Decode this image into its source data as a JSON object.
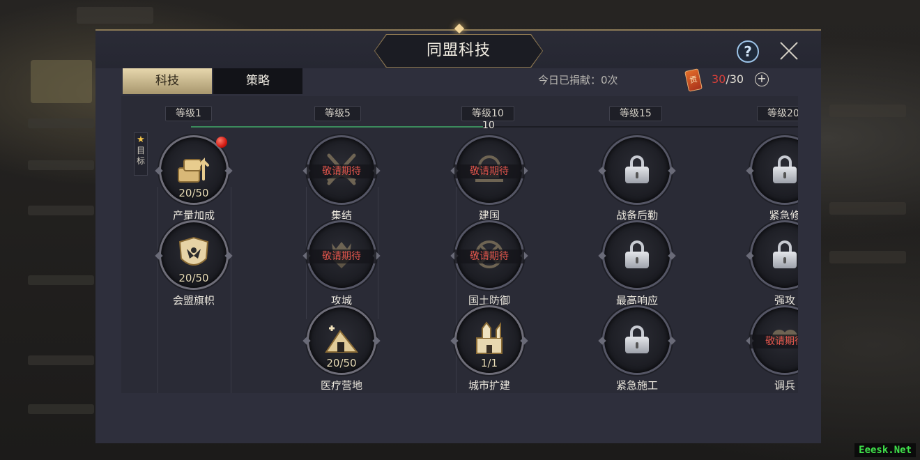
{
  "window": {
    "title": "同盟科技",
    "help_label": "?",
    "close_label": "close"
  },
  "tabs": [
    {
      "label": "科技",
      "active": true
    },
    {
      "label": "策略",
      "active": false
    }
  ],
  "donation": {
    "text": "今日已捐献：0次",
    "token_icon_label": "贡",
    "token_current": "30",
    "token_separator": "/",
    "token_max": "30",
    "plus_label": "+"
  },
  "levels": [
    {
      "label": "等级1"
    },
    {
      "label": "等级5"
    },
    {
      "label": "等级10"
    },
    {
      "label": "等级15"
    },
    {
      "label": "等级20"
    }
  ],
  "progress": {
    "label": "10",
    "fraction": 0.48
  },
  "goal": {
    "star": "★",
    "chars": [
      "目",
      "标"
    ]
  },
  "coming_soon_text": "敬请期待",
  "nodes": [
    {
      "name": "产量加成",
      "count": "20/50",
      "state": "unlocked",
      "icon": "resources-icon",
      "red_dot": true
    },
    {
      "name": "会盟旗帜",
      "count": "20/50",
      "state": "unlocked",
      "icon": "banner-shield-icon",
      "red_dot": false
    },
    {
      "name": "集结",
      "state": "coming-soon",
      "icon": "crossed-swords-icon"
    },
    {
      "name": "攻城",
      "state": "coming-soon",
      "icon": "siege-crown-icon"
    },
    {
      "name": "医疗营地",
      "count": "20/50",
      "state": "unlocked",
      "icon": "medical-tent-icon"
    },
    {
      "name": "建国",
      "state": "coming-soon",
      "icon": "founding-emblem-icon"
    },
    {
      "name": "国土防御",
      "state": "coming-soon",
      "icon": "territory-defense-icon"
    },
    {
      "name": "城市扩建",
      "count": "1/1",
      "state": "unlocked",
      "icon": "castle-icon"
    },
    {
      "name": "战备后勤",
      "state": "locked",
      "icon": "lock-icon"
    },
    {
      "name": "最高响应",
      "state": "locked",
      "icon": "lock-icon"
    },
    {
      "name": "紧急施工",
      "state": "locked",
      "icon": "lock-icon"
    },
    {
      "name": "紧急修",
      "state": "locked",
      "icon": "lock-icon"
    },
    {
      "name": "强攻",
      "state": "locked",
      "icon": "lock-icon"
    },
    {
      "name": "调兵",
      "state": "coming-soon",
      "icon": "troop-icon"
    }
  ],
  "watermark": "Eeesk.Net"
}
